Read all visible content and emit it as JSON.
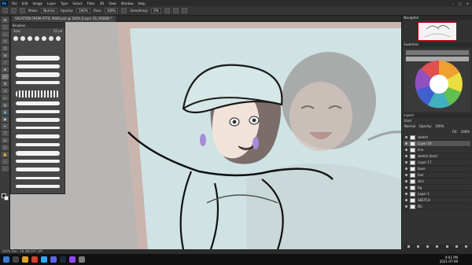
{
  "app": {
    "logo_text": "Ps"
  },
  "menu": [
    "File",
    "Edit",
    "Image",
    "Layer",
    "Type",
    "Select",
    "Filter",
    "3D",
    "View",
    "Window",
    "Help"
  ],
  "window_controls": [
    "–",
    "□",
    "✕"
  ],
  "options": {
    "mode_label": "Mode:",
    "mode_value": "Normal",
    "opacity_label": "Opacity:",
    "opacity_value": "100%",
    "flow_label": "Flow:",
    "flow_value": "100%",
    "smoothing_label": "Smoothing:",
    "smoothing_value": "0%"
  },
  "document_tab": {
    "title": "VACATION FROM ATTIC 9000.psd @ 100% (Layer 16, RGB/8) *"
  },
  "brushes_panel": {
    "title": "Brushes",
    "size_label": "Size:",
    "size_value": "12 px"
  },
  "navigator": {
    "title": "Navigator"
  },
  "swatches": {
    "title": "Swatches"
  },
  "layers_panel": {
    "title": "Layers",
    "kind_label": "Kind",
    "blend_mode": "Normal",
    "opacity_label": "Opacity:",
    "opacity_value": "100%",
    "fill_label": "Fill:",
    "fill_value": "100%",
    "layers": [
      "sketch",
      "Layer 16",
      "line",
      "sketch (hair)",
      "Layer 17",
      "base",
      "hair",
      "skin",
      "bg",
      "Layer 1",
      "SKETCH",
      "BG"
    ]
  },
  "status": {
    "text": "100%    Doc: 28.3M/197.1M"
  },
  "taskbar": {
    "time": "9:01 PM",
    "date": "2021-07-09"
  },
  "colors": {
    "canvas_bg": "#cfe3e4",
    "frame": "#c9b5ae",
    "accent": "#31a8ff"
  }
}
